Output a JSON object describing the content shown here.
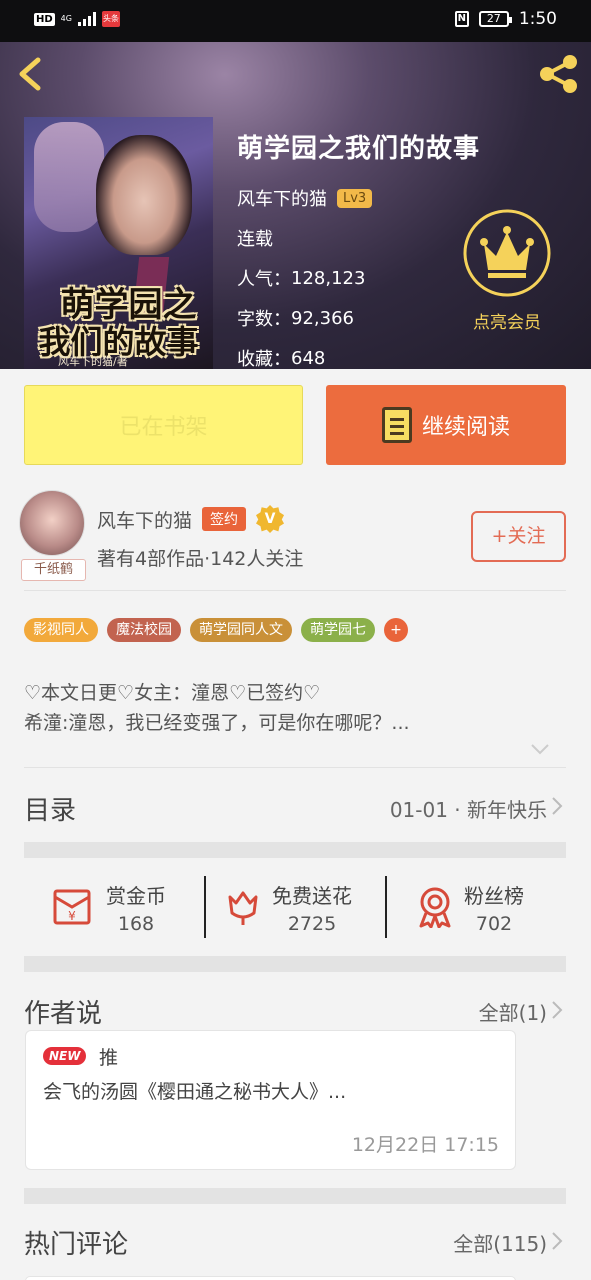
{
  "status_bar": {
    "hd": "HD",
    "network": "4G",
    "app_badge": "头条",
    "nfc": "N",
    "battery": "27",
    "time": "1:50"
  },
  "book": {
    "title": "萌学园之我们的故事",
    "author": "风车下的猫",
    "level": "Lv3",
    "status": "连载",
    "popularity_label": "人气：",
    "popularity": "128,123",
    "words_label": "字数：",
    "words": "92,366",
    "favorites_label": "收藏：",
    "favorites": "648",
    "cover": {
      "title_line1": "萌学园之",
      "title_line2": "我们的故事",
      "author_line": "风车下的猫/著"
    }
  },
  "vip": {
    "label": "点亮会员"
  },
  "actions": {
    "shelf_label": "已在书架",
    "read_label": "继续阅读"
  },
  "author": {
    "avatar_tag": "千纸鹤",
    "name": "风车下的猫",
    "signed_label": "签约",
    "v_badge": "V",
    "works": "著有4部作品·142人关注",
    "follow_label": "+关注"
  },
  "tags": [
    {
      "label": "影视同人",
      "color": "#f2a93b"
    },
    {
      "label": "魔法校园",
      "color": "#c2634f"
    },
    {
      "label": "萌学园同人文",
      "color": "#c99038"
    },
    {
      "label": "萌学园七",
      "color": "#8bb04a"
    }
  ],
  "tags_more": "+",
  "intro": {
    "line1": "♡本文日更♡女主：潼恩♡已签约♡",
    "line2": "希潼:潼恩，我已经变强了，可是你在哪呢？..."
  },
  "toc": {
    "title": "目录",
    "latest": "01-01 · 新年快乐"
  },
  "rewards": [
    {
      "name": "赏金币",
      "value": "168"
    },
    {
      "name": "免费送花",
      "value": "2725"
    },
    {
      "name": "粉丝榜",
      "value": "702"
    }
  ],
  "author_says": {
    "title": "作者说",
    "all": "全部(1)",
    "badge": "NEW",
    "post_title": "推",
    "post_text": "会飞的汤圆《樱田通之秘书大人》...",
    "date": "12月22日  17:15"
  },
  "comments": {
    "title": "热门评论",
    "all": "全部(115)"
  },
  "colors": {
    "accent": "#ec6c3e",
    "gold": "#f5d25a",
    "shelf": "#fff477"
  }
}
